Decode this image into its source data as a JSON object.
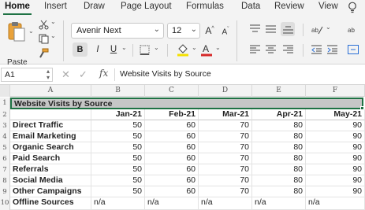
{
  "ribbon": {
    "tabs": [
      "Home",
      "Insert",
      "Draw",
      "Page Layout",
      "Formulas",
      "Data",
      "Review",
      "View"
    ],
    "active_tab": "Home",
    "paste_label": "Paste",
    "font_name": "Avenir Next",
    "font_size": "12",
    "bold": "B",
    "italic": "I",
    "underline": "U",
    "accent_color": "#1f7244",
    "font_color": "#d62828",
    "fill_color": "#f4e000"
  },
  "formula_bar": {
    "name_box": "A1",
    "fx": "fx",
    "formula": "Website Visits by Source"
  },
  "sheet": {
    "columns": [
      "A",
      "B",
      "C",
      "D",
      "E",
      "F"
    ],
    "rows": [
      "1",
      "2",
      "3",
      "4",
      "5",
      "6",
      "7",
      "8",
      "9",
      "10"
    ],
    "title": "Website Visits by Source",
    "months": [
      "Jan-21",
      "Feb-21",
      "Mar-21",
      "Apr-21",
      "May-21"
    ],
    "sources": [
      {
        "name": "Direct Traffic",
        "values": [
          "50",
          "60",
          "70",
          "80",
          "90"
        ]
      },
      {
        "name": "Email Marketing",
        "values": [
          "50",
          "60",
          "70",
          "80",
          "90"
        ]
      },
      {
        "name": "Organic Search",
        "values": [
          "50",
          "60",
          "70",
          "80",
          "90"
        ]
      },
      {
        "name": "Paid Search",
        "values": [
          "50",
          "60",
          "70",
          "80",
          "90"
        ]
      },
      {
        "name": "Referrals",
        "values": [
          "50",
          "60",
          "70",
          "80",
          "90"
        ]
      },
      {
        "name": "Social Media",
        "values": [
          "50",
          "60",
          "70",
          "80",
          "90"
        ]
      },
      {
        "name": "Other Campaigns",
        "values": [
          "50",
          "60",
          "70",
          "80",
          "90"
        ]
      },
      {
        "name": "Offline Sources",
        "values": [
          "n/a",
          "n/a",
          "n/a",
          "n/a",
          "n/a"
        ]
      }
    ]
  }
}
